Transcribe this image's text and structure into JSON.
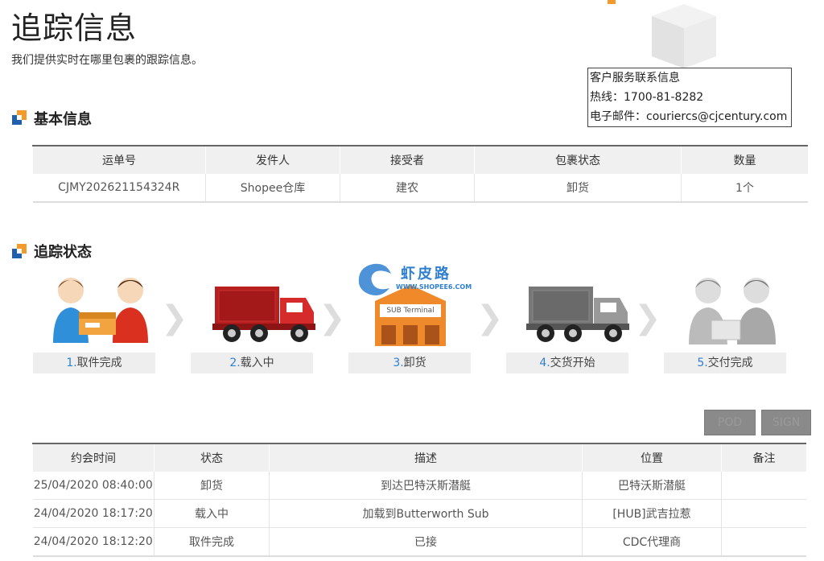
{
  "page": {
    "title": "追踪信息",
    "subtitle": "我们提供实时在哪里包裹的跟踪信息。"
  },
  "contact": {
    "heading": "客户服务联系信息",
    "hotline": "热线：1700-81-8282",
    "email": "电子邮件：couriercs@cjcentury.com"
  },
  "basic_info": {
    "heading": "基本信息",
    "columns": [
      "运单号",
      "发件人",
      "接受者",
      "包裹状态",
      "数量"
    ],
    "row": [
      "CJMY202621154324R",
      "Shopee仓库",
      "建农",
      "卸货",
      "1个"
    ]
  },
  "tracking_status": {
    "heading": "追踪状态",
    "watermark_name": "虾皮路",
    "watermark_url": "WWW.SHOPEE6.COM",
    "terminal_sign": "SUB Terminal",
    "steps": [
      {
        "num": "1.",
        "label": "取件完成",
        "icon": "handover-icon"
      },
      {
        "num": "2.",
        "label": "载入中",
        "icon": "red-truck-icon"
      },
      {
        "num": "3.",
        "label": "卸货",
        "icon": "terminal-building-icon"
      },
      {
        "num": "4.",
        "label": "交货开始",
        "icon": "gray-truck-icon"
      },
      {
        "num": "5.",
        "label": "交付完成",
        "icon": "delivered-icon"
      }
    ],
    "accent_color": "#2f7fd1"
  },
  "buttons": {
    "pod": "POD",
    "sign": "SIGN"
  },
  "tracking_table": {
    "columns": [
      "约会时间",
      "状态",
      "描述",
      "位置",
      "备注"
    ],
    "rows": [
      [
        "25/04/2020 08:40:00",
        "卸货",
        "到达巴特沃斯潜艇",
        "巴特沃斯潜艇",
        ""
      ],
      [
        "24/04/2020 18:17:20",
        "载入中",
        "加载到Butterworth Sub",
        "[HUB]武吉拉惹",
        ""
      ],
      [
        "24/04/2020 18:12:20",
        "取件完成",
        "已接",
        "CDC代理商",
        ""
      ]
    ]
  }
}
